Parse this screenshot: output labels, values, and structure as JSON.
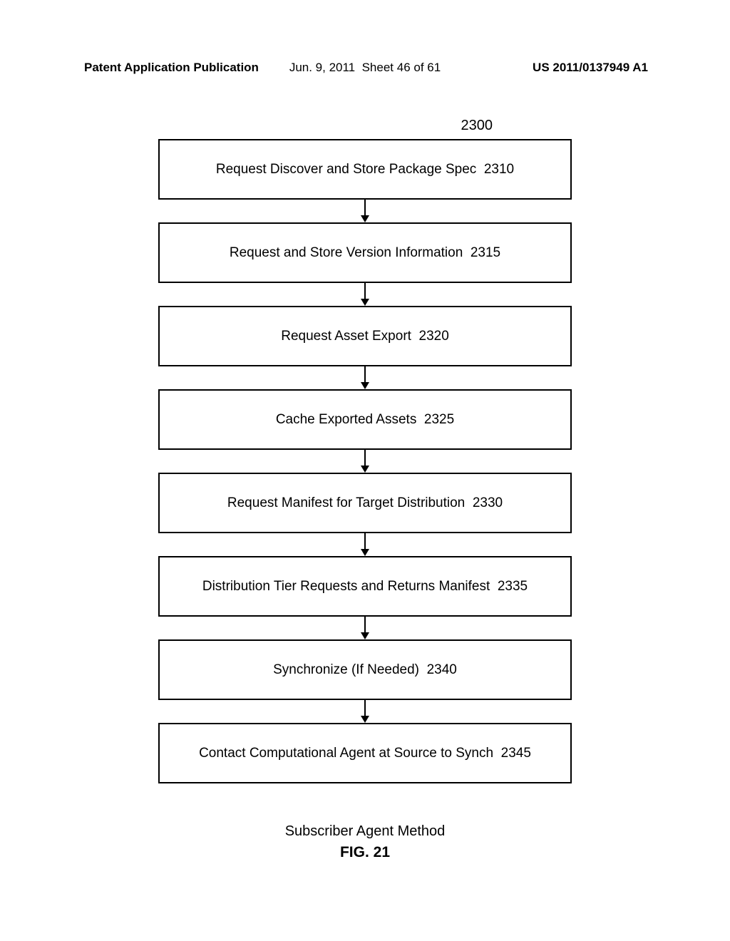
{
  "header": {
    "left": "Patent Application Publication",
    "date": "Jun. 9, 2011",
    "sheet": "Sheet 46 of 61",
    "right": "US 2011/0137949 A1"
  },
  "diagram_number": "2300",
  "steps": [
    {
      "label": "Request Discover and Store Package Spec",
      "ref": "2310"
    },
    {
      "label": "Request and Store Version Information",
      "ref": "2315"
    },
    {
      "label": "Request Asset Export",
      "ref": "2320"
    },
    {
      "label": "Cache Exported Assets",
      "ref": "2325"
    },
    {
      "label": "Request Manifest for Target Distribution",
      "ref": "2330"
    },
    {
      "label": "Distribution Tier Requests and Returns Manifest",
      "ref": "2335"
    },
    {
      "label": "Synchronize (If Needed)",
      "ref": "2340"
    },
    {
      "label": "Contact Computational Agent at Source to Synch",
      "ref": "2345"
    }
  ],
  "caption": {
    "title": "Subscriber Agent Method",
    "figure": "FIG. 21"
  }
}
